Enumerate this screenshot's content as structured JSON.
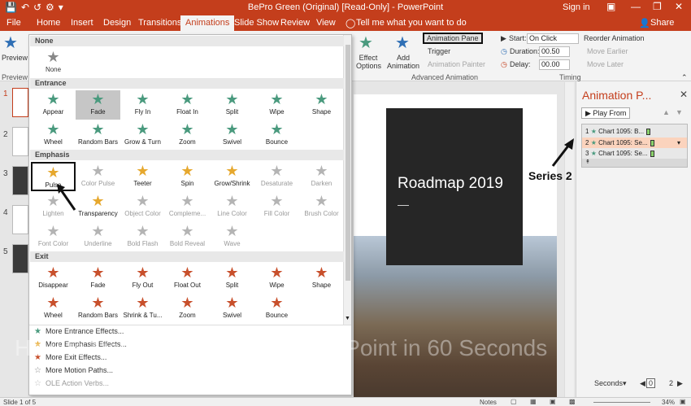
{
  "title": "BePro Green (Original) [Read-Only] - PowerPoint",
  "signin": "Sign in",
  "share": "Share",
  "tabs": [
    "File",
    "Home",
    "Insert",
    "Design",
    "Transitions",
    "Animations",
    "Slide Show",
    "Review",
    "View"
  ],
  "active_tab": "Animations",
  "tellme": "Tell me what you want to do",
  "ribbon": {
    "preview": "Preview",
    "preview_group": "Preview",
    "effect_options": "Effect Options",
    "add_animation": "Add Animation",
    "animation_pane": "Animation Pane",
    "trigger": "Trigger",
    "animation_painter": "Animation Painter",
    "advanced_group": "Advanced Animation",
    "start_label": "Start:",
    "start_value": "On Click",
    "duration_label": "Duration:",
    "duration_value": "00.50",
    "delay_label": "Delay:",
    "delay_value": "00.00",
    "reorder": "Reorder Animation",
    "move_earlier": "Move Earlier",
    "move_later": "Move Later",
    "timing_group": "Timing"
  },
  "gallery": {
    "none_header": "None",
    "none_label": "None",
    "entrance_header": "Entrance",
    "entrance": [
      "Appear",
      "Fade",
      "Fly In",
      "Float In",
      "Split",
      "Wipe",
      "Shape",
      "Wheel",
      "Random Bars",
      "Grow & Turn",
      "Zoom",
      "Swivel",
      "Bounce"
    ],
    "emphasis_header": "Emphasis",
    "emphasis": [
      "Pulse",
      "Color Pulse",
      "Teeter",
      "Spin",
      "Grow/Shrink",
      "Desaturate",
      "Darken",
      "Lighten",
      "Transparency",
      "Object Color",
      "Compleme...",
      "Line Color",
      "Fill Color",
      "Brush Color",
      "Font Color",
      "Underline",
      "Bold Flash",
      "Bold Reveal",
      "Wave"
    ],
    "exit_header": "Exit",
    "exit": [
      "Disappear",
      "Fade",
      "Fly Out",
      "Float Out",
      "Split",
      "Wipe",
      "Shape",
      "Wheel",
      "Random Bars",
      "Shrink & Tu...",
      "Zoom",
      "Swivel",
      "Bounce"
    ],
    "more": [
      "More Entrance Effects...",
      "More Emphasis Effects...",
      "More Exit Effects...",
      "More Motion Paths...",
      "OLE Action Verbs..."
    ]
  },
  "slide": {
    "title": "Roadmap 2019"
  },
  "thumb_numbers": [
    "1",
    "2",
    "3",
    "4",
    "5"
  ],
  "anim_pane": {
    "title": "Animation P...",
    "play_from": "Play From",
    "items": [
      {
        "num": "1",
        "label": "Chart 1095: B..."
      },
      {
        "num": "2",
        "label": "Chart 1095: Se..."
      },
      {
        "num": "3",
        "label": "Chart 1095: Se..."
      }
    ],
    "seconds": "Seconds",
    "page_a": "0",
    "page_b": "2"
  },
  "callout": "Series 2",
  "watermark": "How to Use Animations in PowerPoint in 60 Seconds",
  "status": {
    "slide": "Slide 1 of 5",
    "notes": "Notes",
    "zoom": "34%"
  },
  "colors": {
    "accent": "#c43e1c",
    "entrance": "#4a9a7e",
    "emphasis": "#e6a82e",
    "exit": "#c8502c"
  }
}
